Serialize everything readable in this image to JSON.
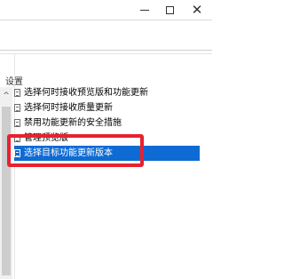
{
  "window": {
    "controls": {
      "minimize_icon": "minimize-icon",
      "maximize_icon": "maximize-icon",
      "close_glyph": "✕"
    }
  },
  "section": {
    "label": "设置"
  },
  "scrollbar": {
    "up_arrow": "^"
  },
  "settings_list": {
    "items": [
      {
        "label": "选择何时接收预览版和功能更新",
        "selected": false
      },
      {
        "label": "选择何时接收质量更新",
        "selected": false
      },
      {
        "label": "禁用功能更新的安全措施",
        "selected": false
      },
      {
        "label": "管理预览版",
        "selected": false
      },
      {
        "label": "选择目标功能更新版本",
        "selected": true
      }
    ]
  },
  "colors": {
    "selection": "#0f6bd4",
    "highlight_box": "#e8212f"
  }
}
